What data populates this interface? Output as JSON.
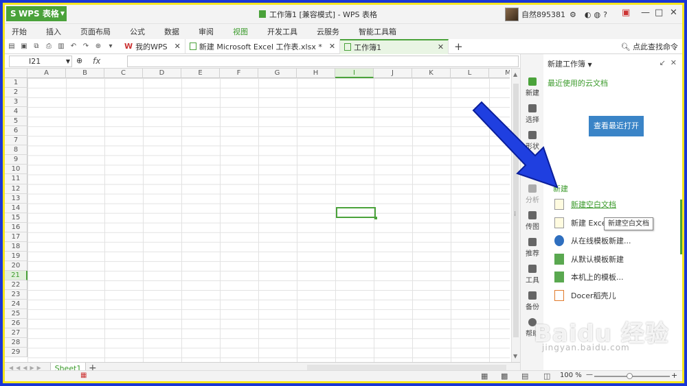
{
  "app": {
    "button_label": "WPS 表格",
    "doc_title": "工作簿1 [兼容模式] - WPS 表格"
  },
  "user": {
    "name": "自然895381"
  },
  "menu": {
    "items": [
      "开始",
      "插入",
      "页面布局",
      "公式",
      "数据",
      "审阅",
      "视图",
      "开发工具",
      "云服务",
      "智能工具箱"
    ],
    "active": "视图"
  },
  "tabs": [
    {
      "label": "我的WPS"
    },
    {
      "label": "新建 Microsoft Excel 工作表.xlsx *"
    },
    {
      "label": "工作簿1"
    }
  ],
  "find_command": "点此查找命令",
  "formula": {
    "namebox": "I21",
    "fx": "fx"
  },
  "columns": [
    "A",
    "B",
    "C",
    "D",
    "E",
    "F",
    "G",
    "H",
    "I",
    "J",
    "K",
    "L",
    "M"
  ],
  "rows": [
    "1",
    "2",
    "3",
    "4",
    "5",
    "6",
    "7",
    "8",
    "9",
    "10",
    "11",
    "12",
    "13",
    "14",
    "15",
    "16",
    "17",
    "18",
    "19",
    "20",
    "21",
    "22",
    "23",
    "24",
    "25",
    "26",
    "27",
    "28",
    "29"
  ],
  "selected": {
    "column": "I",
    "row": "21"
  },
  "sheet": {
    "tab": "Sheet1"
  },
  "status": {
    "zoom": "100 %"
  },
  "strip": [
    "新建",
    "选择",
    "形状",
    "分析",
    "传图",
    "推荐",
    "工具",
    "备份",
    "帮助"
  ],
  "panel": {
    "title": "新建工作簿",
    "cloud_title": "最近使用的云文档",
    "open_button": "查看最近打开",
    "section": "新建",
    "items": [
      "新建空白文档",
      "新建 Excel",
      "从在线模板新建...",
      "从默认模板新建",
      "本机上的模板...",
      "Docer稻壳儿"
    ],
    "tooltip": "新建空白文档"
  },
  "watermark": {
    "main": "Baidu 经验",
    "sub": "jingyan.baidu.com"
  }
}
